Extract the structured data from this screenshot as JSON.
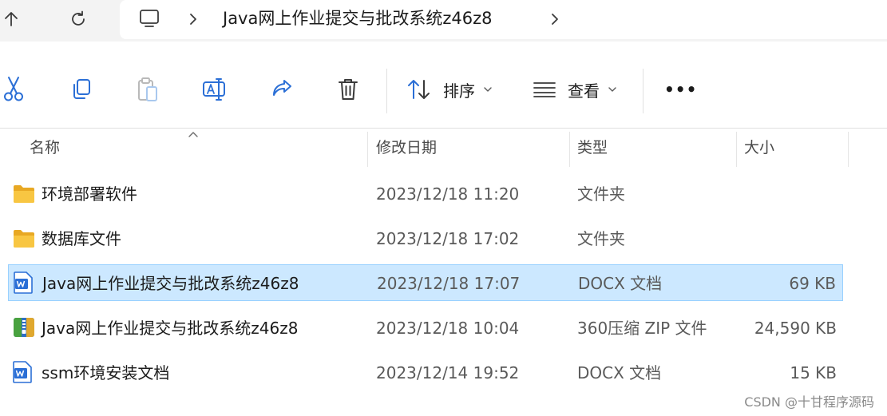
{
  "address_bar": {
    "path": "Java网上作业提交与批改系统z46z8"
  },
  "toolbar": {
    "sort_label": "排序",
    "view_label": "查看",
    "more_label": "•••"
  },
  "columns": {
    "name": "名称",
    "date": "修改日期",
    "type": "类型",
    "size": "大小"
  },
  "files": [
    {
      "name": "环境部署软件",
      "date": "2023/12/18 11:20",
      "type": "文件夹",
      "size": "",
      "icon": "folder-icon",
      "selected": false
    },
    {
      "name": "数据库文件",
      "date": "2023/12/18 17:02",
      "type": "文件夹",
      "size": "",
      "icon": "folder-icon",
      "selected": false
    },
    {
      "name": "Java网上作业提交与批改系统z46z8",
      "date": "2023/12/18 17:07",
      "type": "DOCX 文档",
      "size": "69 KB",
      "icon": "wps-doc-icon",
      "selected": true
    },
    {
      "name": "Java网上作业提交与批改系统z46z8",
      "date": "2023/12/18 10:04",
      "type": "360压缩 ZIP 文件",
      "size": "24,590 KB",
      "icon": "zip-archive-icon",
      "selected": false
    },
    {
      "name": "ssm环境安装文档",
      "date": "2023/12/14 19:52",
      "type": "DOCX 文档",
      "size": "15 KB",
      "icon": "wps-doc-icon",
      "selected": false
    }
  ],
  "watermark": "CSDN @十甘程序源码",
  "colors": {
    "selection_bg": "#cce8ff",
    "selection_border": "#99d1ff",
    "folder": "#f8c642",
    "doc_blue": "#2b6fd6"
  }
}
